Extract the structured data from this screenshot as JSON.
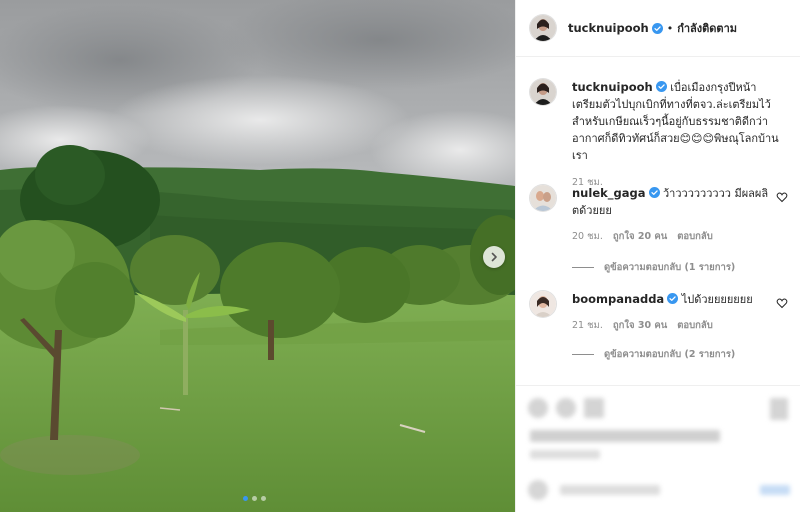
{
  "post": {
    "username": "tucknuipooh",
    "follow_label": "กำลังติดตาม",
    "separator": "•"
  },
  "caption": {
    "username": "tucknuipooh",
    "text": "เบื่อเมืองกรุงปีหน้าเตรียมตัวไปบุกเบิกที่ทางที่ตจว.ล่ะเตรียมไว้สำหรับเกษียณเร็วๆนี้อยู่กับธรรมชาติดีกว่าอากาศก็ดีทิวทัศน์ก็สวย😊😊😊พิษณุโลกบ้านเรา",
    "time": "21 ชม."
  },
  "comments": [
    {
      "username": "nulek_gaga",
      "text": "ว้าววววววววว มีผลผลิตด้วยยย",
      "time": "20 ชม.",
      "likes": "ถูกใจ 20 คน",
      "reply_label": "ตอบกลับ",
      "view_replies": "ดูข้อความตอบกลับ (1 รายการ)"
    },
    {
      "username": "boompanadda",
      "text": "ไปด้วยยยยยยย",
      "time": "21 ชม.",
      "likes": "ถูกใจ 30 คน",
      "reply_label": "ตอบกลับ",
      "view_replies": "ดูข้อความตอบกลับ (2 รายการ)"
    }
  ],
  "icons": {
    "verified": "verified-badge-icon",
    "heart": "heart-outline-icon",
    "next": "chevron-right-icon"
  },
  "colors": {
    "verified": "#3897f0",
    "muted": "#8e8e8e",
    "text": "#262626",
    "carousel_active": "#3897f0"
  },
  "carousel": {
    "count": 3,
    "active_index": 0
  }
}
